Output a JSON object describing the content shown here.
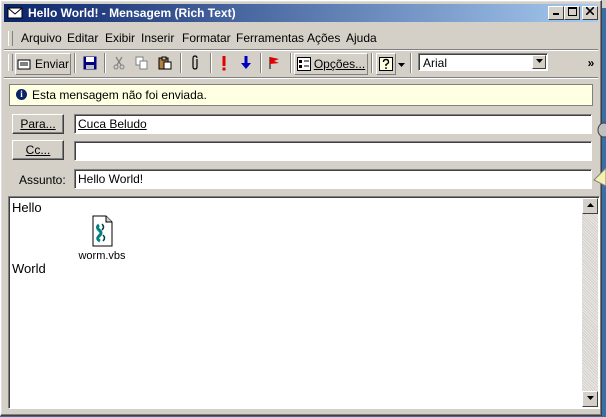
{
  "window": {
    "title": "Hello World! - Mensagem (Rich Text)",
    "controls": {
      "minimize": "_",
      "maximize": "□",
      "close": "×"
    }
  },
  "menu": {
    "items": [
      "Arquivo",
      "Editar",
      "Exibir",
      "Inserir",
      "Formatar",
      "Ferramentas",
      "Ações",
      "Ajuda"
    ]
  },
  "toolbar": {
    "send_label": "Enviar",
    "options_label": "Opções...",
    "font_value": "Arial",
    "more_glyph": "»"
  },
  "infobar": {
    "text": "Esta mensagem não foi enviada."
  },
  "to": {
    "button": "Para...",
    "value": "Cuca Beludo"
  },
  "cc": {
    "button": "Cc...",
    "value": ""
  },
  "subject": {
    "label": "Assunto:",
    "value": "Hello World!"
  },
  "body": {
    "line1": "Hello",
    "line2": "World",
    "attachment": "worm.vbs"
  },
  "colors": {
    "title_gradient_start": "#0a246a",
    "title_gradient_end": "#a6caf0",
    "infobar_bg": "#ffffe1",
    "chrome": "#d4d0c8"
  }
}
